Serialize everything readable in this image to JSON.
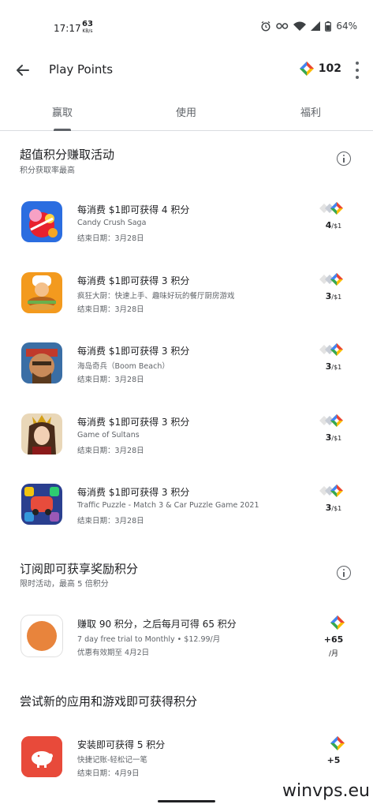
{
  "status_bar": {
    "time": "17:17",
    "net_speed": "63",
    "net_unit": "KB/s",
    "battery": "64%"
  },
  "appbar": {
    "title": "Play Points",
    "points": "102"
  },
  "tabs": [
    {
      "label": "赢取",
      "active": true
    },
    {
      "label": "使用",
      "active": false
    },
    {
      "label": "福利",
      "active": false
    }
  ],
  "section1": {
    "title": "超值积分赚取活动",
    "subtitle": "积分获取率最高",
    "items": [
      {
        "title": "每消费 $1即可获得 4 积分",
        "app": "Candy Crush Saga",
        "date": "结束日期：3月28日",
        "rate": "4",
        "per": "/$1",
        "icon": "candy-crush-icon"
      },
      {
        "title": "每消费 $1即可获得 3 积分",
        "app": "疯狂大厨：快速上手、趣味好玩的餐厅厨房游戏",
        "date": "结束日期：3月28日",
        "rate": "3",
        "per": "/$1",
        "icon": "cooking-fever-icon"
      },
      {
        "title": "每消费 $1即可获得 3 积分",
        "app": "海岛奇兵（Boom Beach）",
        "date": "结束日期：3月28日",
        "rate": "3",
        "per": "/$1",
        "icon": "boom-beach-icon"
      },
      {
        "title": "每消费 $1即可获得 3 积分",
        "app": "Game of Sultans",
        "date": "结束日期：3月28日",
        "rate": "3",
        "per": "/$1",
        "icon": "game-of-sultans-icon"
      },
      {
        "title": "每消费 $1即可获得 3 积分",
        "app": "Traffic Puzzle - Match 3 & Car Puzzle Game 2021",
        "date": "结束日期：3月28日",
        "rate": "3",
        "per": "/$1",
        "icon": "traffic-puzzle-icon"
      }
    ]
  },
  "section2": {
    "title": "订阅即可获享奖励积分",
    "subtitle": "限时活动，最高 5 倍积分",
    "item": {
      "title": "赚取 90 积分，之后每月可得 65 积分",
      "app": "7 day free trial to Monthly  • $12.99/月",
      "date": "优惠有效期至 4月2日",
      "rate": "+65",
      "per": "/月"
    }
  },
  "section3": {
    "title": "尝试新的应用和游戏即可获得积分",
    "item": {
      "title": "安装即可获得 5 积分",
      "app": "快捷记账-轻松记一笔",
      "date": "结束日期：4月9日",
      "rate": "+5"
    }
  },
  "watermark": "winvps.eu",
  "colors": {
    "accent": "#4285f4",
    "tab_indicator": "#5f6368"
  }
}
